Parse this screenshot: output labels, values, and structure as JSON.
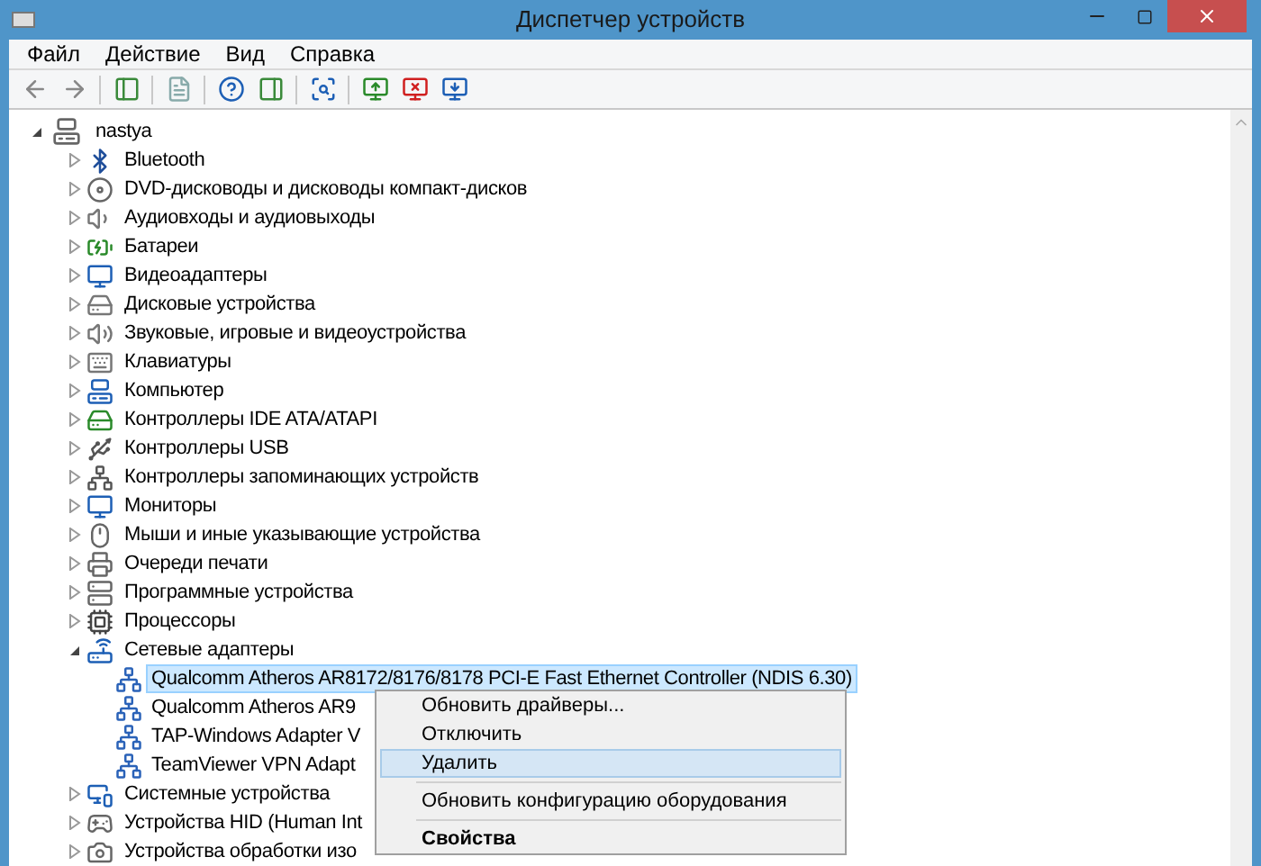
{
  "window": {
    "title": "Диспетчер устройств"
  },
  "menu_bar": [
    "Файл",
    "Действие",
    "Вид",
    "Справка"
  ],
  "tree": {
    "label": "nastya",
    "expanded": true,
    "selected": false,
    "children": [
      {
        "label": "Bluetooth",
        "expanded": false,
        "selected": false
      },
      {
        "label": "DVD-дисководы и дисководы компакт-дисков",
        "expanded": false,
        "selected": false
      },
      {
        "label": "Аудиовходы и аудиовыходы",
        "expanded": false,
        "selected": false
      },
      {
        "label": "Батареи",
        "expanded": false,
        "selected": false
      },
      {
        "label": "Видеоадаптеры",
        "expanded": false,
        "selected": false
      },
      {
        "label": "Дисковые устройства",
        "expanded": false,
        "selected": false
      },
      {
        "label": "Звуковые, игровые и видеоустройства",
        "expanded": false,
        "selected": false
      },
      {
        "label": "Клавиатуры",
        "expanded": false,
        "selected": false
      },
      {
        "label": "Компьютер",
        "expanded": false,
        "selected": false
      },
      {
        "label": "Контроллеры IDE ATA/ATAPI",
        "expanded": false,
        "selected": false
      },
      {
        "label": "Контроллеры USB",
        "expanded": false,
        "selected": false
      },
      {
        "label": "Контроллеры запоминающих устройств",
        "expanded": false,
        "selected": false
      },
      {
        "label": "Мониторы",
        "expanded": false,
        "selected": false
      },
      {
        "label": "Мыши и иные указывающие устройства",
        "expanded": false,
        "selected": false
      },
      {
        "label": "Очереди печати",
        "expanded": false,
        "selected": false
      },
      {
        "label": "Программные устройства",
        "expanded": false,
        "selected": false
      },
      {
        "label": "Процессоры",
        "expanded": false,
        "selected": false
      },
      {
        "label": "Сетевые адаптеры",
        "expanded": true,
        "selected": false,
        "children": [
          {
            "label": "Qualcomm Atheros AR8172/8176/8178 PCI-E Fast Ethernet Controller (NDIS 6.30)",
            "selected": true
          },
          {
            "label": "Qualcomm Atheros AR9",
            "selected": false
          },
          {
            "label": "TAP-Windows Adapter V",
            "selected": false
          },
          {
            "label": "TeamViewer VPN Adapt",
            "selected": false
          }
        ]
      },
      {
        "label": "Системные устройства",
        "expanded": false,
        "selected": false
      },
      {
        "label": "Устройства HID (Human Int",
        "expanded": false,
        "selected": false
      },
      {
        "label": "Устройства обработки изо",
        "expanded": false,
        "selected": false
      }
    ]
  },
  "context_menu": {
    "groups": [
      [
        {
          "label": "Обновить драйверы...",
          "selected": false,
          "bold": false
        },
        {
          "label": "Отключить",
          "selected": false,
          "bold": false
        },
        {
          "label": "Удалить",
          "selected": true,
          "bold": false
        }
      ],
      [
        {
          "label": "Обновить конфигурацию оборудования",
          "selected": false,
          "bold": false
        }
      ],
      [
        {
          "label": "Свойства",
          "selected": false,
          "bold": true
        }
      ]
    ]
  }
}
